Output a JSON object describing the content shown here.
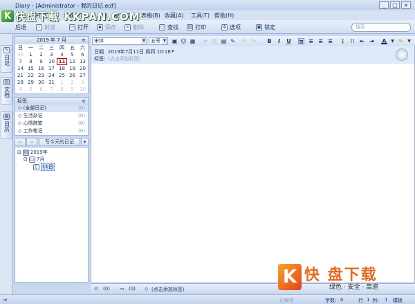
{
  "window": {
    "title": "Diary - [Administrator - 我的日记.edf]",
    "controls": [
      "_",
      "□",
      "×"
    ]
  },
  "brand": {
    "logo_text": "快盘下载 KKPAN.COM",
    "logo_mark": "K"
  },
  "menu": [
    "文件(F)",
    "编辑(E)",
    "插入(I)",
    "格式(O)",
    "表格(B)",
    "收藏(A)",
    "工具(T)",
    "帮助(H)"
  ],
  "toolbar": {
    "back": "后退",
    "forward": "前进",
    "open": "打开",
    "save": "保存",
    "delete": "删除",
    "find": "查找",
    "print": "打印",
    "options": "选项",
    "lock": "锁定",
    "search_placeholder": "搜索"
  },
  "left_tabs": [
    {
      "label": "日记"
    },
    {
      "label": "文档"
    },
    {
      "label": "日历"
    }
  ],
  "calendar": {
    "title": "2019 年 7 月",
    "weekdays": [
      "日",
      "一",
      "二",
      "三",
      "四",
      "五",
      "六"
    ],
    "weeks": [
      [
        "30",
        "1",
        "2",
        "3",
        "4",
        "5",
        "6"
      ],
      [
        "7",
        "8",
        "9",
        "10",
        "11",
        "12",
        "13"
      ],
      [
        "14",
        "15",
        "16",
        "17",
        "18",
        "19",
        "20"
      ],
      [
        "21",
        "22",
        "23",
        "24",
        "25",
        "26",
        "27"
      ],
      [
        "28",
        "29",
        "30",
        "31",
        "1",
        "2",
        "3"
      ],
      [
        "4",
        "5",
        "6",
        "7",
        "8",
        "9",
        "10"
      ]
    ],
    "today": "11"
  },
  "tags": {
    "header": "标签:",
    "items": [
      {
        "label": "(全部日记)",
        "count": "(0)"
      },
      {
        "label": "生活杂记",
        "count": "(0)"
      },
      {
        "label": "心情随笔",
        "count": "(0)"
      },
      {
        "label": "工作笔记",
        "count": "(0)"
      }
    ]
  },
  "nav": {
    "prev": "<",
    "next": ">",
    "today_label": "写今天的日记"
  },
  "tree": {
    "year": "2019年",
    "month": "7月",
    "day": "11日"
  },
  "format": {
    "font": "宋体",
    "size": "五号"
  },
  "entry": {
    "date_label": "日期",
    "date_value": "2019年7月11日 周四 10:18",
    "tag_label": "标签:",
    "tag_placeholder": "(点击添加标签)"
  },
  "status": {
    "attachments": "(0)",
    "comments": "(0)",
    "tag_hint": "(点击添加标签)"
  },
  "bottom": {
    "saved": "已保存",
    "words_label": "字数:",
    "words": "0",
    "row_label": "行",
    "row": "1",
    "col_label": "列:",
    "col": "1",
    "mode": "模板"
  },
  "watermark": {
    "mark": "K",
    "title": "快 盘下载",
    "slogan": "绿色 · 安全 · 高速"
  }
}
